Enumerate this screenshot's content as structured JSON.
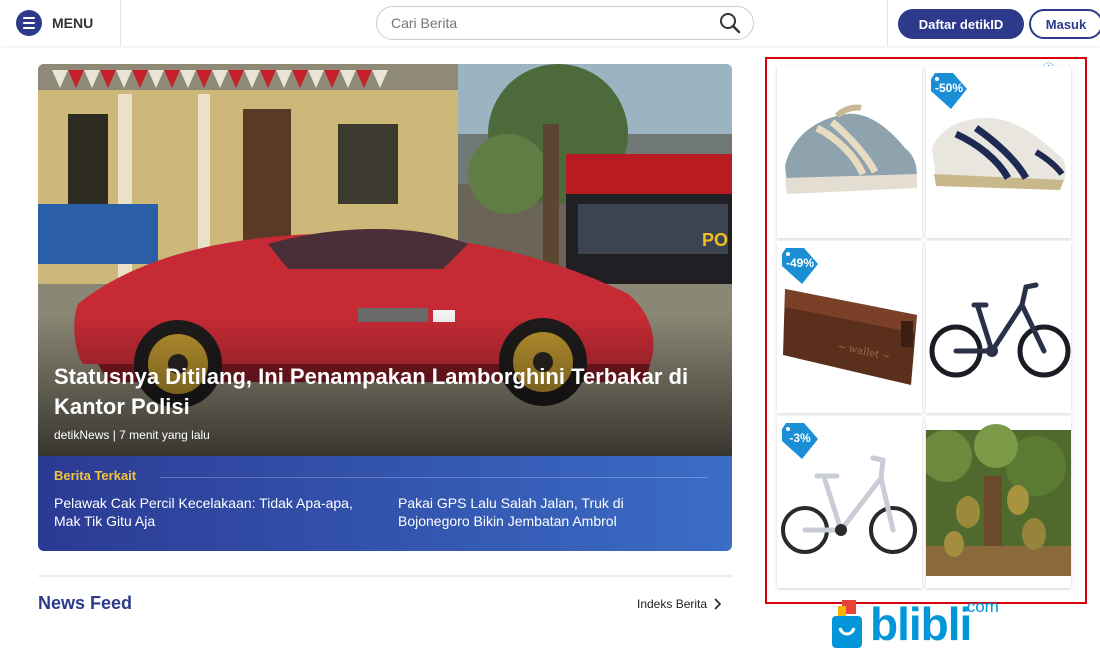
{
  "header": {
    "menu_label": "MENU",
    "search_placeholder": "Cari Berita",
    "register_label": "Daftar detikID",
    "login_label": "Masuk"
  },
  "headline": {
    "title": "Statusnya Ditilang, Ini Penampakan Lamborghini Terbakar di Kantor Polisi",
    "meta": "detikNews | 7 menit yang lalu",
    "related_heading": "Berita Terkait",
    "related": [
      "Pelawak Cak Percil Kecelakaan: Tidak Apa-apa, Mak Tik Gitu Aja",
      "Pakai GPS Lalu Salah Jalan, Truk di Bojonegoro Bikin Jembatan Ambrol"
    ]
  },
  "feed": {
    "title": "News Feed",
    "index_link": "Indeks Berita"
  },
  "ad": {
    "tiles": [
      {
        "name": "shoes-product",
        "badge": ""
      },
      {
        "name": "shoes-product",
        "badge": "-50%"
      },
      {
        "name": "wallet-product",
        "badge": "-49%"
      },
      {
        "name": "bicycle-product",
        "badge": ""
      },
      {
        "name": "bicycle-product",
        "badge": "-3%"
      },
      {
        "name": "durian-tree-product",
        "badge": ""
      }
    ],
    "brand": "blibli",
    "brand_suffix": ".com"
  },
  "colors": {
    "brand_blue": "#2d3a8c",
    "ad_border": "#d9000d",
    "related_heading": "#f4c33a",
    "blibli_blue": "#0096d9"
  }
}
